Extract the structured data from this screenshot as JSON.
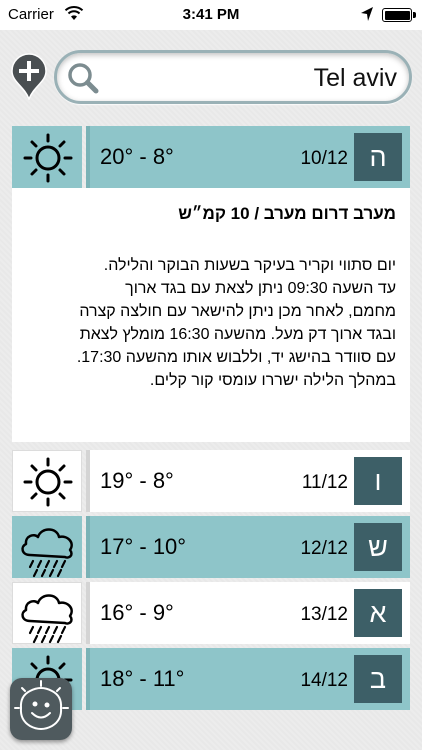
{
  "status_bar": {
    "carrier": "Carrier",
    "time": "3:41 PM",
    "battery_percent": 100
  },
  "search": {
    "value": "Tel aviv",
    "placeholder": ""
  },
  "icons": {
    "add_location": "add-location-pin-icon",
    "search": "magnifier-icon",
    "sunny": "sun-icon",
    "rain": "cloud-rain-icon",
    "app": "smiley-sun-icon"
  },
  "colors": {
    "teal": "#8ec5c9",
    "day_badge": "#3d5f67",
    "search_border": "#9ab1b6"
  },
  "forecast": [
    {
      "day": "ה",
      "date": "10/12",
      "temp": "20° - 8°",
      "weather": "sunny",
      "highlight": true,
      "expanded": true
    },
    {
      "day": "ו",
      "date": "11/12",
      "temp": "19° - 8°",
      "weather": "sunny",
      "highlight": false
    },
    {
      "day": "ש",
      "date": "12/12",
      "temp": "17° - 10°",
      "weather": "rain",
      "highlight": true
    },
    {
      "day": "א",
      "date": "13/12",
      "temp": "16° - 9°",
      "weather": "rain",
      "highlight": false
    },
    {
      "day": "ב",
      "date": "14/12",
      "temp": "18° - 11°",
      "weather": "sunny",
      "highlight": true
    }
  ],
  "detail": {
    "wind": "מערב דרום מערב / 10 קמ״ש",
    "text": [
      "יום סתווי וקריר בעיקר בשעות הבוקר והלילה.",
      "עד השעה 09:30 ניתן לצאת עם בגד ארוך",
      "מחמם, לאחר מכן ניתן להישאר עם חולצה קצרה",
      "ובגד ארוך דק מעל. מהשעה 16:30 מומלץ לצאת",
      "עם סוודר בהישג יד, וללבוש אותו מהשעה 17:30.",
      "במהלך הלילה ישררו עומסי קור קלים."
    ]
  }
}
